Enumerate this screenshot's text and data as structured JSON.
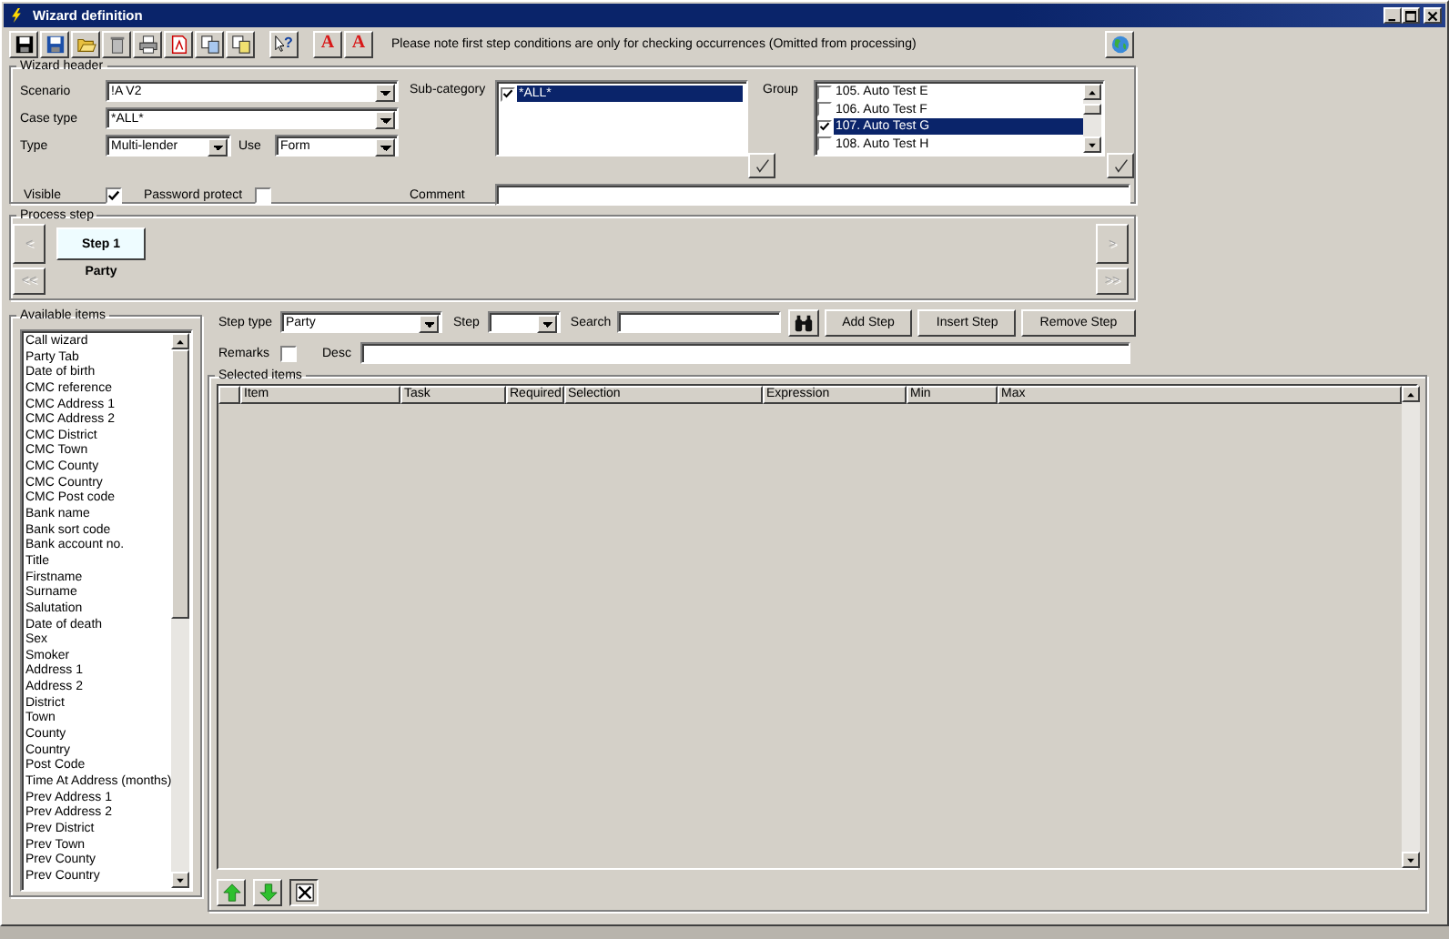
{
  "window": {
    "title": "Wizard definition"
  },
  "toolbar": {
    "tools": [
      {
        "kind": "save"
      },
      {
        "kind": "save_as"
      },
      {
        "kind": "open"
      },
      {
        "kind": "delete"
      },
      {
        "kind": "print"
      },
      {
        "kind": "pdf"
      },
      {
        "kind": "copy"
      },
      {
        "kind": "swap"
      },
      {
        "kind": "help",
        "glyph": "?"
      },
      {
        "kind": "font_up",
        "glyph": "A"
      },
      {
        "kind": "font_down",
        "glyph": "A"
      }
    ],
    "notice": "Please note first step conditions are only for checking occurrences (Omitted from processing)"
  },
  "wizard_header": {
    "title": "Wizard header",
    "scenario": {
      "label": "Scenario",
      "value": "!A V2"
    },
    "case_type": {
      "label": "Case type",
      "value": "*ALL*"
    },
    "type": {
      "label": "Type",
      "value": "Multi-lender"
    },
    "use": {
      "label": "Use",
      "value": "Form"
    },
    "visible": {
      "label": "Visible",
      "checked": true
    },
    "password_protect": {
      "label": "Password protect",
      "checked": false
    },
    "sub_category": {
      "label": "Sub-category",
      "items": [
        {
          "label": "*ALL*",
          "checked": true,
          "selected": true
        }
      ]
    },
    "group": {
      "label": "Group",
      "items": [
        {
          "label": "105. Auto Test E",
          "checked": false,
          "selected": false
        },
        {
          "label": "106. Auto Test F",
          "checked": false,
          "selected": false
        },
        {
          "label": "107. Auto Test G",
          "checked": true,
          "selected": true
        },
        {
          "label": "108. Auto Test H",
          "checked": false,
          "selected": false
        }
      ]
    },
    "comment": {
      "label": "Comment"
    }
  },
  "process_step": {
    "title": "Process step",
    "first": {
      "label": "<<",
      "disabled": true
    },
    "prev": {
      "label": "<",
      "disabled": true
    },
    "next": {
      "label": ">",
      "disabled": true
    },
    "last": {
      "label": ">>",
      "disabled": true
    },
    "steps": [
      {
        "label": "Step 1",
        "sublabel": "Party",
        "selected": true
      }
    ]
  },
  "available_items": {
    "title": "Available items",
    "items": [
      "Call wizard",
      "Party Tab",
      "Date of birth",
      "CMC reference",
      "CMC Address 1",
      "CMC Address 2",
      "CMC District",
      "CMC Town",
      "CMC County",
      "CMC Country",
      "CMC Post code",
      "Bank name",
      "Bank sort code",
      "Bank account no.",
      "Title",
      "Firstname",
      "Surname",
      "Salutation",
      "Date of death",
      "Sex",
      "Smoker",
      "Address 1",
      "Address 2",
      "District",
      "Town",
      "County",
      "Country",
      "Post Code",
      "Time At Address (months)",
      "Prev Address 1",
      "Prev Address 2",
      "Prev District",
      "Prev Town",
      "Prev County",
      "Prev Country"
    ]
  },
  "step_editor": {
    "step_type": {
      "label": "Step type",
      "value": "Party"
    },
    "step": {
      "label": "Step"
    },
    "search": {
      "label": "Search"
    },
    "buttons": [
      "Add Step",
      "Insert Step",
      "Remove Step"
    ],
    "remarks": {
      "label": "Remarks",
      "checked": false
    },
    "desc": {
      "label": "Desc"
    }
  },
  "selected_items": {
    "title": "Selected items",
    "columns": [
      "Item",
      "Task",
      "Required",
      "Selection",
      "Expression",
      "Min",
      "Max"
    ]
  }
}
